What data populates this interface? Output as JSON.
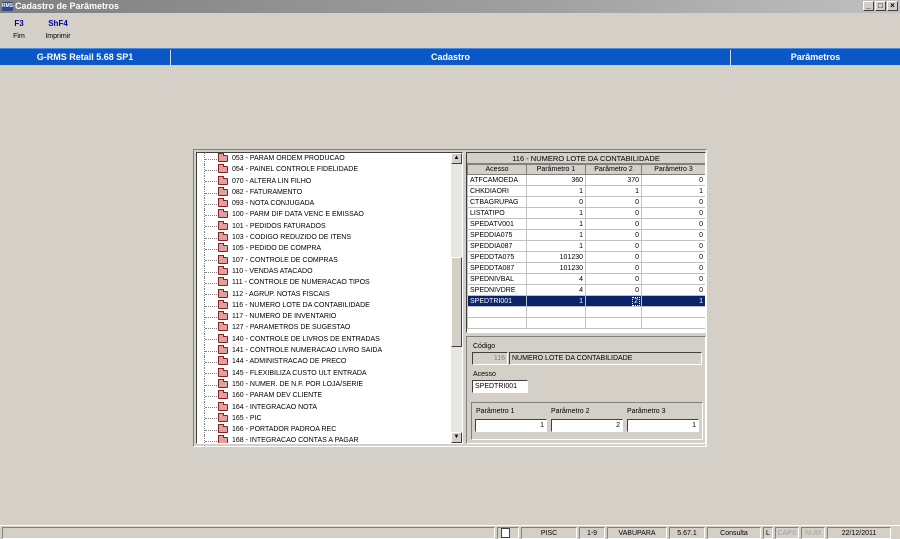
{
  "window": {
    "icon_text": "RMS",
    "title": "Cadastro de Parâmetros",
    "controls": [
      "_",
      "□",
      "×"
    ]
  },
  "toolbar": {
    "items": [
      {
        "key": "F3",
        "label": "Fim"
      },
      {
        "key": "ShF4",
        "label": "Imprimir"
      }
    ]
  },
  "header": {
    "product": "G-RMS Retail 5.68 SP1",
    "section": "Cadastro",
    "module": "Parâmetros"
  },
  "tree": {
    "items": [
      "053 - PARAM ORDEM PRODUCAO",
      "054 - PAINEL CONTROLE FIDELIDADE",
      "070 - ALTERA LIN FILHO",
      "082 - FATURAMENTO",
      "093 - NOTA CONJUGADA",
      "100 - PARM DIF DATA VENC E EMISSAO",
      "101 - PEDIDOS FATURADOS",
      "103 - CODIGO REDUZIDO DE ITENS",
      "105 - PEDIDO DE COMPRA",
      "107 - CONTROLE DE COMPRAS",
      "110 - VENDAS ATACADO",
      "111 - CONTROLE DE NUMERACAO TIPOS",
      "112 - AGRUP. NOTAS FISCAIS",
      "116 - NUMERO LOTE DA CONTABILIDADE",
      "117 - NUMERO DE INVENTARIO",
      "127 - PARAMETROS DE SUGESTAO",
      "140 - CONTROLE DE LIVROS DE ENTRADAS",
      "141 - CONTROLE NUMERACAO LIVRO SAIDA",
      "144 - ADMINISTRACAO DE PRECO",
      "145 - FLEXIBILIZA CUSTO ULT ENTRADA",
      "150 - NUMER. DE N.F. POR LOJA/SERIE",
      "160 - PARAM DEV CLIENTE",
      "164 - INTEGRACAO NOTA",
      "165 - PIC",
      "166 - PORTADOR PADROA REC",
      "168 - INTEGRACAO CONTAS A PAGAR"
    ],
    "scroll_up": "▲",
    "scroll_down": "▼"
  },
  "grid": {
    "title": "116 - NUMERO LOTE DA CONTABILIDADE",
    "columns": [
      "Acesso",
      "Parâmetro 1",
      "Parâmetro 2",
      "Parâmetro 3"
    ],
    "rows": [
      [
        "ATFCAMOEDA",
        "360",
        "370",
        "0"
      ],
      [
        "CHKDIAORI",
        "1",
        "1",
        "1"
      ],
      [
        "CTBAGRUPAG",
        "0",
        "0",
        "0"
      ],
      [
        "LISTATIPO",
        "1",
        "0",
        "0"
      ],
      [
        "SPEDATV001",
        "1",
        "0",
        "0"
      ],
      [
        "SPEDDIA075",
        "1",
        "0",
        "0"
      ],
      [
        "SPEDDIA087",
        "1",
        "0",
        "0"
      ],
      [
        "SPEDDTA075",
        "101230",
        "0",
        "0"
      ],
      [
        "SPEDDTA087",
        "101230",
        "0",
        "0"
      ],
      [
        "SPEDNIVBAL",
        "4",
        "0",
        "0"
      ],
      [
        "SPEDNIVDRE",
        "4",
        "0",
        "0"
      ],
      [
        "SPEDTRI001",
        "1",
        "2",
        "1"
      ]
    ],
    "selected_row": 11
  },
  "form": {
    "codigo_label": "Código",
    "codigo_value": "116",
    "codigo_desc": "NUMERO LOTE DA CONTABILIDADE",
    "acesso_label": "Acesso",
    "acesso_value": "SPEDTRI001",
    "param1_label": "Parâmetro 1",
    "param1_value": "1",
    "param2_label": "Parâmetro 2",
    "param2_value": "2",
    "param3_label": "Parâmetro 3",
    "param3_value": "1"
  },
  "status": {
    "segments": [
      "PISC",
      "1-9",
      "VABUPARA",
      "5.67.1",
      "Consulta",
      "L",
      "CAPS",
      "NUM",
      "22/12/2011"
    ]
  }
}
